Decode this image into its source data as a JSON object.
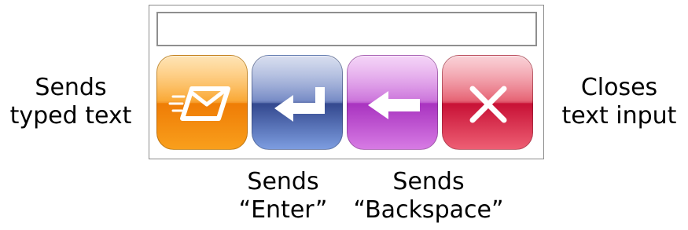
{
  "input": {
    "value": "",
    "placeholder": ""
  },
  "keys": [
    {
      "name": "send",
      "icon": "send-mail-icon",
      "color": "#f99b16"
    },
    {
      "name": "enter",
      "icon": "enter-arrow-icon",
      "color": "#34498f"
    },
    {
      "name": "backspace",
      "icon": "backspace-arrow-icon",
      "color": "#a934c0"
    },
    {
      "name": "close",
      "icon": "close-x-icon",
      "color": "#c81236"
    }
  ],
  "captions": {
    "send": [
      "Sends",
      "typed text"
    ],
    "close": [
      "Closes",
      "text input"
    ],
    "enter": [
      "Sends",
      "“Enter”"
    ],
    "backspace": [
      "Sends",
      "“Backspace”"
    ]
  }
}
